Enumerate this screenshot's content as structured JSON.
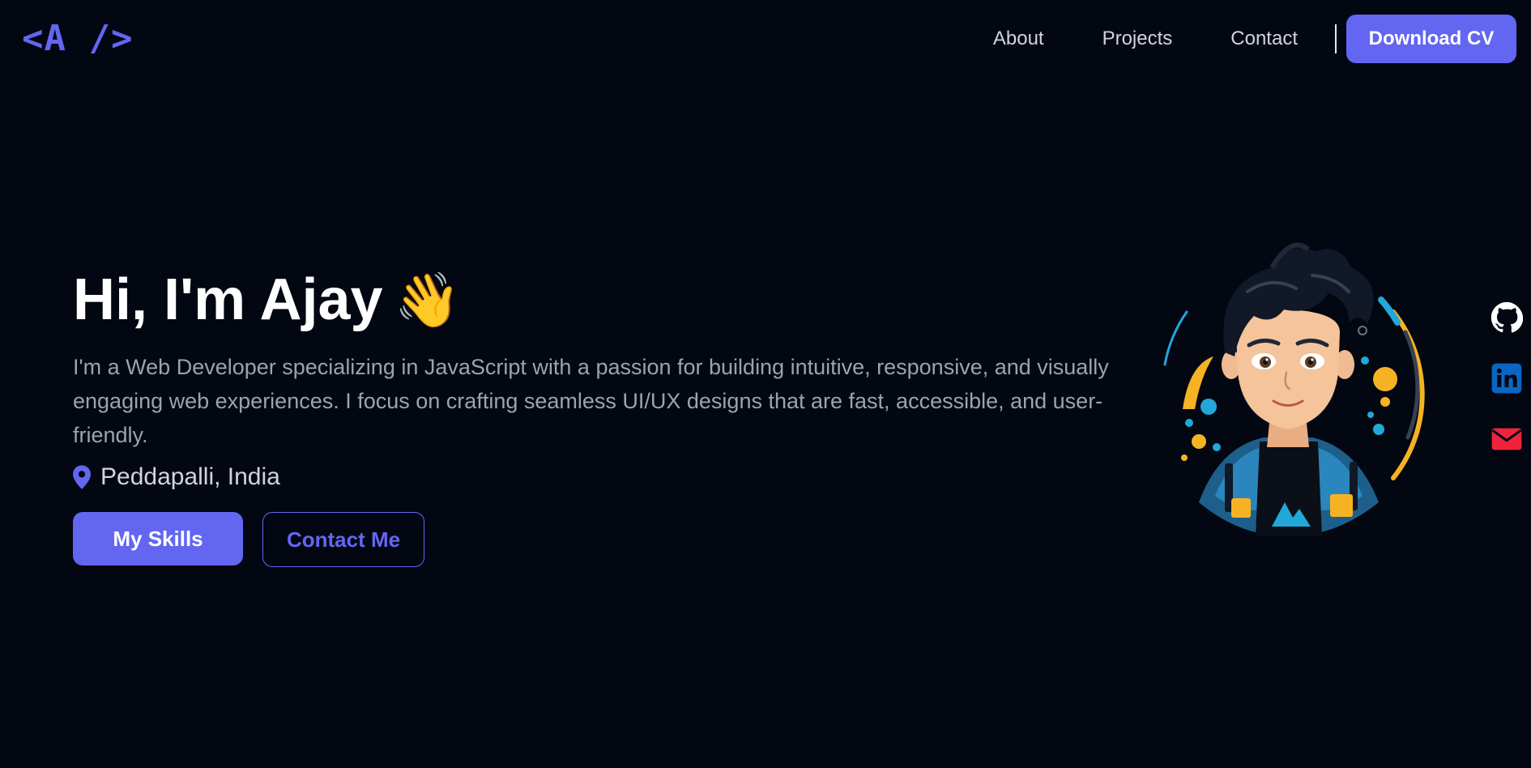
{
  "brand": {
    "logo": "<A />"
  },
  "nav": {
    "items": [
      {
        "label": "About"
      },
      {
        "label": "Projects"
      },
      {
        "label": "Contact"
      }
    ],
    "cta_label": "Download CV"
  },
  "hero": {
    "greeting": "Hi, I'm Ajay",
    "wave_emoji": "👋",
    "description": "I'm a Web Developer specializing in JavaScript with a passion for building intuitive, responsive, and visually engaging web experiences. I focus on crafting seamless UI/UX designs that are fast, accessible, and user-friendly.",
    "location": "Peddapalli, India",
    "primary_button": "My Skills",
    "secondary_button": "Contact Me"
  },
  "social": {
    "items": [
      {
        "icon": "github-icon"
      },
      {
        "icon": "linkedin-icon"
      },
      {
        "icon": "mail-icon"
      }
    ]
  },
  "colors": {
    "background": "#030712",
    "accent": "#6366f1",
    "linkedin": "#0a66c2",
    "mail": "#ef233c"
  }
}
